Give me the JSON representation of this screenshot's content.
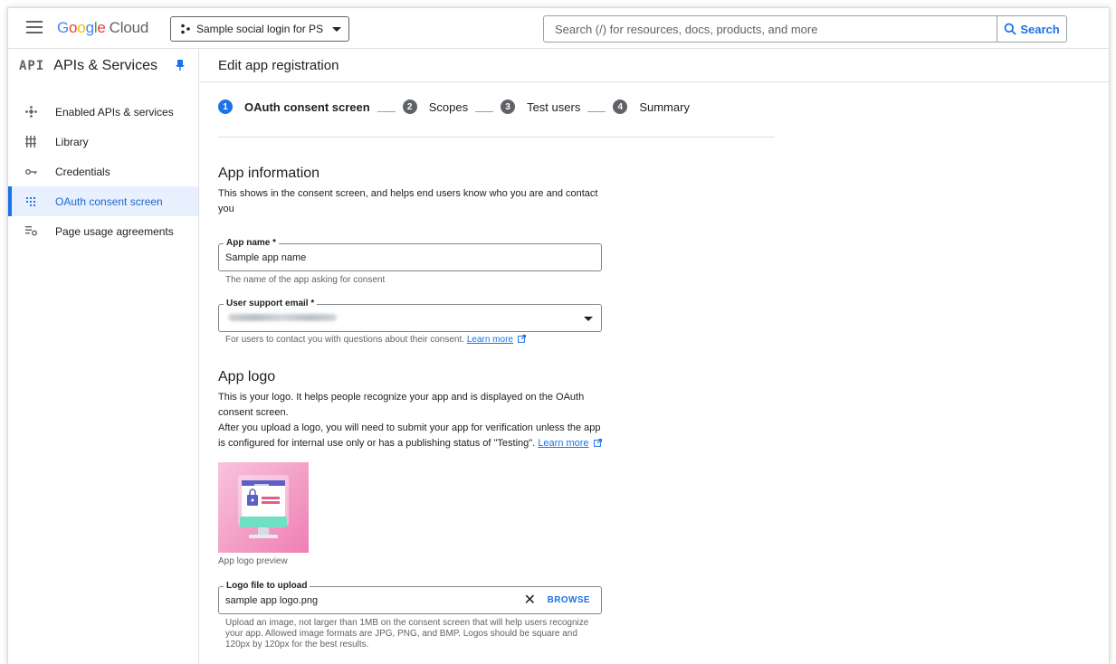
{
  "topbar": {
    "logo_word": [
      "G",
      "o",
      "o",
      "g",
      "l",
      "e"
    ],
    "logo_product": "Cloud",
    "project_name": "Sample social login for PS",
    "search_placeholder": "Search (/) for resources, docs, products, and more",
    "search_button": "Search"
  },
  "sidebar": {
    "badge": "API",
    "title": "APIs & Services",
    "items": [
      {
        "label": "Enabled APIs & services",
        "icon": "api-diamond-icon"
      },
      {
        "label": "Library",
        "icon": "library-grid-icon"
      },
      {
        "label": "Credentials",
        "icon": "key-icon"
      },
      {
        "label": "OAuth consent screen",
        "icon": "consent-dots-icon",
        "active": true
      },
      {
        "label": "Page usage agreements",
        "icon": "settings-list-icon"
      }
    ]
  },
  "page": {
    "title": "Edit app registration",
    "steps": [
      {
        "num": "1",
        "label": "OAuth consent screen",
        "current": true
      },
      {
        "num": "2",
        "label": "Scopes"
      },
      {
        "num": "3",
        "label": "Test users"
      },
      {
        "num": "4",
        "label": "Summary"
      }
    ],
    "app_info": {
      "title": "App information",
      "description": "This shows in the consent screen, and helps end users know who you are and contact you",
      "app_name_label": "App name *",
      "app_name_value": "Sample app name",
      "app_name_helper": "The name of the app asking for consent",
      "support_email_label": "User support email *",
      "support_email_helper": "For users to contact you with questions about their consent.",
      "learn_more": "Learn more"
    },
    "app_logo": {
      "title": "App logo",
      "description_1": "This is your logo. It helps people recognize your app and is displayed on the OAuth consent screen.",
      "description_2": "After you upload a logo, you will need to submit your app for verification unless the app is configured for internal use only or has a publishing status of \"Testing\".",
      "learn_more": "Learn more",
      "preview_caption": "App logo preview",
      "file_label": "Logo file to upload",
      "file_value": "sample app logo.png",
      "clear_glyph": "✕",
      "browse": "BROWSE",
      "file_helper_lines": [
        "Upload an image, not larger than 1MB on the consent screen that will help users recognize",
        "your app. Allowed image formats are JPG, PNG, and BMP. Logos should be square and",
        "120px by 120px for the best results."
      ]
    }
  },
  "colors": {
    "accent": "#1a73e8",
    "active_bg": "#e8f0fe"
  }
}
